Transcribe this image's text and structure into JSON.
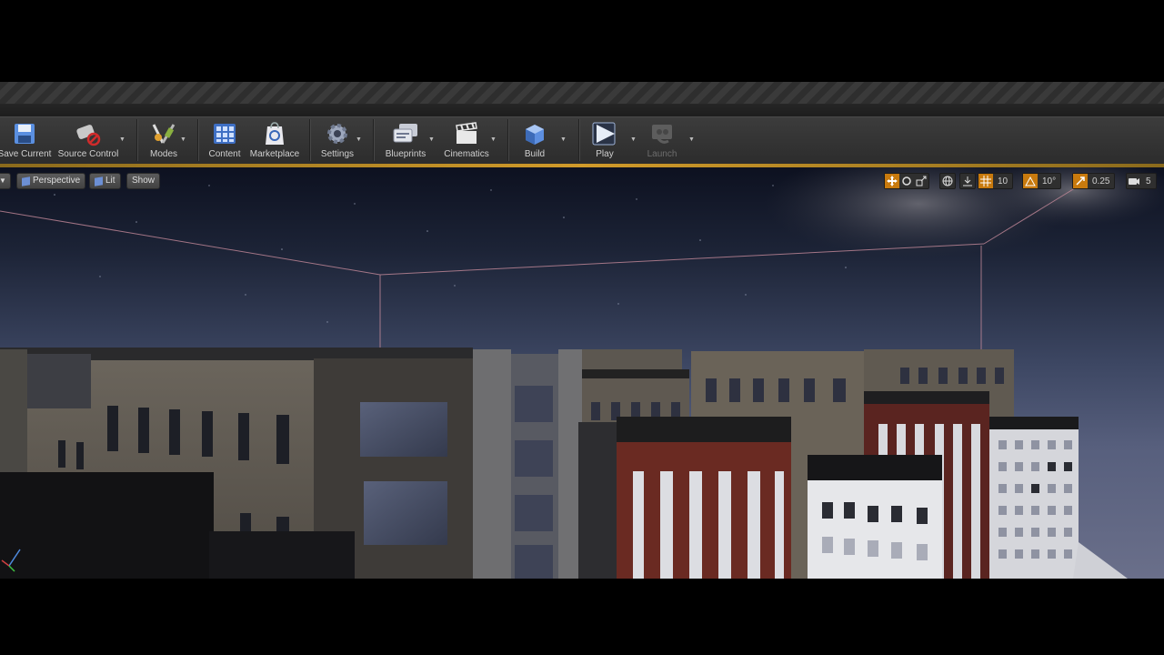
{
  "toolbar": {
    "buttons": [
      {
        "label": "Save Current"
      },
      {
        "label": "Source Control"
      },
      {
        "label": "Modes"
      },
      {
        "label": "Content"
      },
      {
        "label": "Marketplace"
      },
      {
        "label": "Settings"
      },
      {
        "label": "Blueprints"
      },
      {
        "label": "Cinematics"
      },
      {
        "label": "Build"
      },
      {
        "label": "Play"
      },
      {
        "label": "Launch"
      }
    ]
  },
  "viewport": {
    "perspective_label": "Perspective",
    "lit_label": "Lit",
    "show_label": "Show",
    "grid_snap": "10",
    "rotation_snap": "10°",
    "scale_snap": "0.25",
    "camera_speed": "5"
  },
  "colors": {
    "accent": "#d19b2a",
    "snap_active": "#c87a0e"
  }
}
